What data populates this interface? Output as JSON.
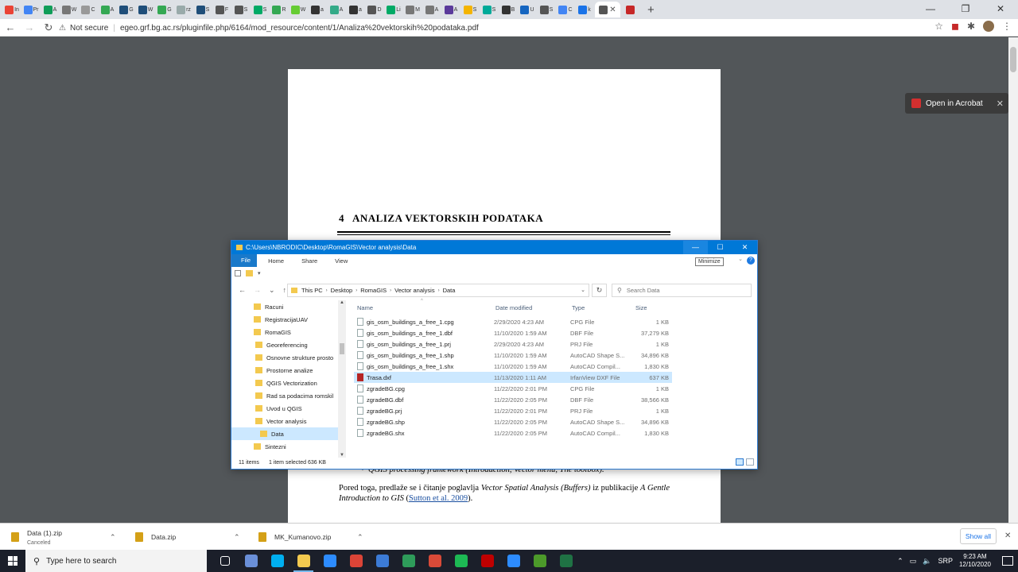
{
  "browser": {
    "tabs": [
      "In",
      "Pr",
      "A",
      "W",
      "C",
      "A",
      "G",
      "W",
      "G",
      "rz",
      "S",
      "F",
      "S",
      "S",
      "R",
      "W",
      "a",
      "A",
      "a",
      "D",
      "Li",
      "M",
      "A",
      "A",
      "S",
      "S",
      "B",
      "U",
      "S",
      "C",
      "k",
      "",
      ""
    ],
    "active_tab_index": 31,
    "tab_colors": [
      "#ea4335",
      "#4285f4",
      "#0f9d58",
      "#777",
      "#999",
      "#34a853",
      "#1f4e79",
      "#1f4e79",
      "#34a853",
      "#9aa",
      "#1f4e79",
      "#555",
      "#555",
      "#0a6",
      "#34a853",
      "#6c3",
      "#333",
      "#3a8",
      "#333",
      "#555",
      "#0a6",
      "#777",
      "#777",
      "#5b3a9b",
      "#f4b400",
      "#0a9",
      "#333",
      "#1565c0",
      "#555",
      "#4285f4",
      "#1a73e8",
      "#555",
      "#c62828"
    ],
    "new_tab": "+",
    "window_controls": [
      "—",
      "❐",
      "✕"
    ],
    "nav": {
      "back": "←",
      "forward": "→",
      "reload": "↻"
    },
    "security_label": "Not secure",
    "url": "egeo.grf.bg.ac.rs/pluginfile.php/6164/mod_resource/content/1/Analiza%20vektorskih%20podataka.pdf",
    "toolbar_icons": [
      "star-icon",
      "acrobat-icon",
      "extensions-icon",
      "profile-avatar"
    ]
  },
  "pdf": {
    "heading_num": "4",
    "heading": "ANALIZA VEKTORSKIH PODATAKA",
    "bullet": "QGIS processing framework (Introduction, Vector menu, The toolbox).",
    "para_a": "Pored toga, predlaže se i čitanje poglavlja ",
    "para_b": "Vector Spatial Analysis (Buffers)",
    "para_c": " iz publikacije ",
    "para_d": "A Gentle Introduction to GIS",
    "para_e": " (",
    "para_link": "Sutton et al. 2009",
    "para_f": ").",
    "open_in_acrobat": "Open in Acrobat",
    "close": "✕"
  },
  "explorer": {
    "title": "C:\\Users\\NBRODIC\\Desktop\\RomaGIS\\Vector analysis\\Data",
    "controls": [
      "—",
      "☐",
      "✕"
    ],
    "tooltip": "Minimize",
    "ribbon": {
      "file": "File",
      "tabs": [
        "Home",
        "Share",
        "View"
      ]
    },
    "address": [
      "This PC",
      "Desktop",
      "RomaGIS",
      "Vector analysis",
      "Data"
    ],
    "search_placeholder": "Search Data",
    "columns": {
      "name": "Name",
      "date": "Date modified",
      "type": "Type",
      "size": "Size"
    },
    "tree": [
      {
        "label": "Racuni",
        "indent": 1,
        "selected": false
      },
      {
        "label": "RegistracijaUAV",
        "indent": 1,
        "selected": false
      },
      {
        "label": "RomaGIS",
        "indent": 1,
        "selected": false
      },
      {
        "label": "Georeferencing",
        "indent": 2,
        "selected": false
      },
      {
        "label": "Osnovne strukture prosto",
        "indent": 2,
        "selected": false
      },
      {
        "label": "Prostorne analize",
        "indent": 2,
        "selected": false
      },
      {
        "label": "QGIS Vectorization",
        "indent": 2,
        "selected": false
      },
      {
        "label": "Rad sa podacima romskil",
        "indent": 2,
        "selected": false
      },
      {
        "label": "Uvod u QGIS",
        "indent": 2,
        "selected": false
      },
      {
        "label": "Vector analysis",
        "indent": 2,
        "selected": false
      },
      {
        "label": "Data",
        "indent": 3,
        "selected": true
      },
      {
        "label": "Sintezni",
        "indent": 1,
        "selected": false
      }
    ],
    "files": [
      {
        "name": "gis_osm_buildings_a_free_1.cpg",
        "date": "2/29/2020 4:23 AM",
        "type": "CPG File",
        "size": "1 KB",
        "selected": false
      },
      {
        "name": "gis_osm_buildings_a_free_1.dbf",
        "date": "11/10/2020 1:59 AM",
        "type": "DBF File",
        "size": "37,279 KB",
        "selected": false
      },
      {
        "name": "gis_osm_buildings_a_free_1.prj",
        "date": "2/29/2020 4:23 AM",
        "type": "PRJ File",
        "size": "1 KB",
        "selected": false
      },
      {
        "name": "gis_osm_buildings_a_free_1.shp",
        "date": "11/10/2020 1:59 AM",
        "type": "AutoCAD Shape S...",
        "size": "34,896 KB",
        "selected": false
      },
      {
        "name": "gis_osm_buildings_a_free_1.shx",
        "date": "11/10/2020 1:59 AM",
        "type": "AutoCAD Compil...",
        "size": "1,830 KB",
        "selected": false
      },
      {
        "name": "Trasa.dxf",
        "date": "11/13/2020 1:11 AM",
        "type": "IrfanView DXF File",
        "size": "637 KB",
        "selected": true
      },
      {
        "name": "zgradeBG.cpg",
        "date": "11/22/2020 2:01 PM",
        "type": "CPG File",
        "size": "1 KB",
        "selected": false
      },
      {
        "name": "zgradeBG.dbf",
        "date": "11/22/2020 2:05 PM",
        "type": "DBF File",
        "size": "38,566 KB",
        "selected": false
      },
      {
        "name": "zgradeBG.prj",
        "date": "11/22/2020 2:01 PM",
        "type": "PRJ File",
        "size": "1 KB",
        "selected": false
      },
      {
        "name": "zgradeBG.shp",
        "date": "11/22/2020 2:05 PM",
        "type": "AutoCAD Shape S...",
        "size": "34,896 KB",
        "selected": false
      },
      {
        "name": "zgradeBG.shx",
        "date": "11/22/2020 2:05 PM",
        "type": "AutoCAD Compil...",
        "size": "1,830 KB",
        "selected": false
      }
    ],
    "status_items": "11 items",
    "status_selected": "1 item selected  636 KB"
  },
  "downloads": {
    "items": [
      {
        "name": "Data (1).zip",
        "sub": "Canceled"
      },
      {
        "name": "Data.zip",
        "sub": ""
      },
      {
        "name": "MK_Kumanovo.zip",
        "sub": ""
      }
    ],
    "show_all": "Show all",
    "close": "✕"
  },
  "taskbar": {
    "search_placeholder": "Type here to search",
    "apps": [
      {
        "name": "task-view",
        "color": "#1b1f2a"
      },
      {
        "name": "r-app",
        "color": "#6a8fd8"
      },
      {
        "name": "skype",
        "color": "#00aff0"
      },
      {
        "name": "file-explorer",
        "color": "#f3c94f"
      },
      {
        "name": "zoom-app",
        "color": "#2d8cff"
      },
      {
        "name": "chrome",
        "color": "#db4437"
      },
      {
        "name": "app-n",
        "color": "#3c7bd6"
      },
      {
        "name": "app-green",
        "color": "#2e9c5a"
      },
      {
        "name": "app-red",
        "color": "#d94a38"
      },
      {
        "name": "app-s",
        "color": "#1db954"
      },
      {
        "name": "filezilla",
        "color": "#bf0000"
      },
      {
        "name": "zoom-meetings",
        "color": "#2d8cff"
      },
      {
        "name": "app-a",
        "color": "#4c9a2a"
      },
      {
        "name": "excel",
        "color": "#1f7244"
      }
    ],
    "active_app_index": 3,
    "lang": "SRP",
    "time": "9:23 AM",
    "date": "12/10/2020"
  }
}
